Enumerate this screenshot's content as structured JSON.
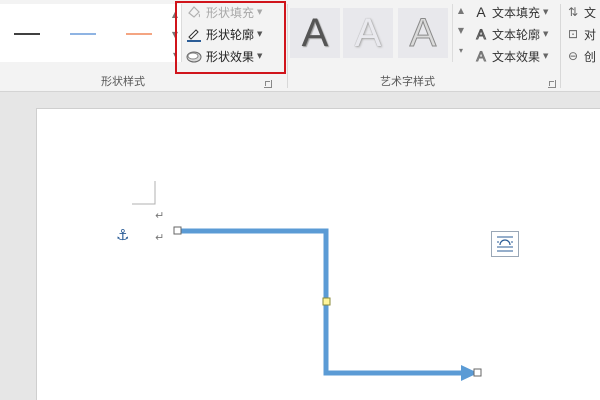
{
  "ribbon": {
    "shape_styles": {
      "label": "形状样式",
      "line_samples": [
        {
          "color": "#404040"
        },
        {
          "color": "#8fb4e3"
        },
        {
          "color": "#f4a582"
        }
      ],
      "fill_label": "形状填充",
      "outline_label": "形状轮廓",
      "effects_label": "形状效果"
    },
    "wordart": {
      "label": "艺术字样式",
      "tiles": [
        {
          "letter": "A",
          "style": "dark-fill"
        },
        {
          "letter": "A",
          "style": "light-fill"
        },
        {
          "letter": "A",
          "style": "outline-gray"
        }
      ],
      "text_fill_label": "文本填充",
      "text_outline_label": "文本轮廓",
      "text_effects_label": "文本效果"
    },
    "arrange": {
      "items": [
        "文",
        "对",
        "创"
      ]
    }
  },
  "document": {
    "paragraph_marks": [
      "↵",
      "↵"
    ],
    "anchor_symbol": "⚓",
    "connector_color": "#5b9bd5"
  },
  "colors": {
    "highlight": "#d0141b",
    "ribbon_bg": "#f3f3f3"
  }
}
